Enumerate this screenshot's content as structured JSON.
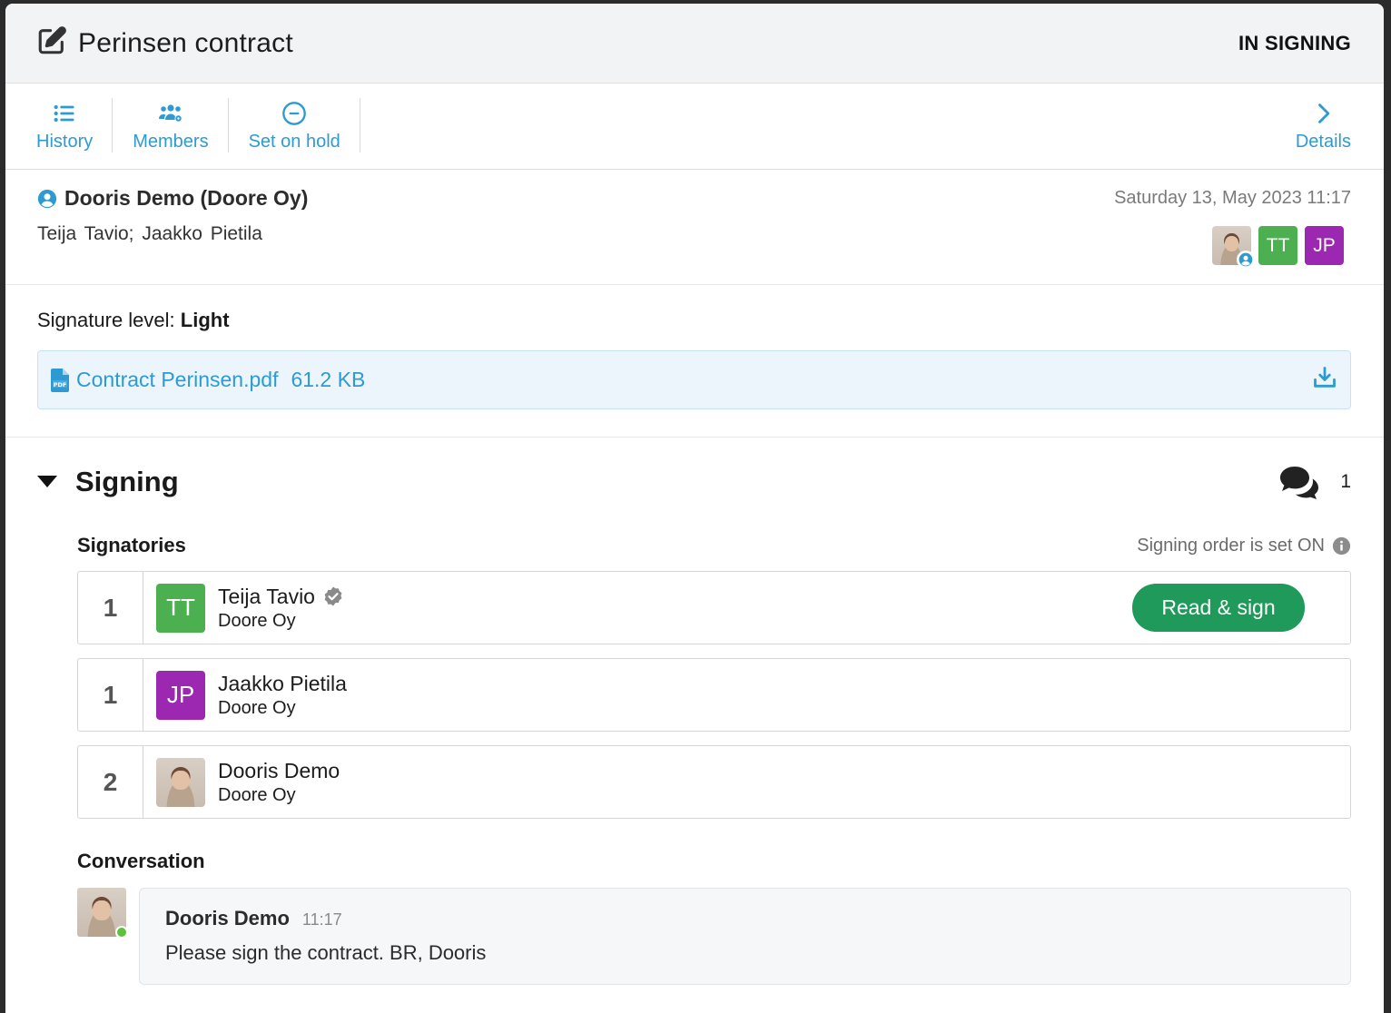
{
  "header": {
    "title": "Perinsen contract",
    "status": "IN SIGNING"
  },
  "toolbar": {
    "history_label": "History",
    "members_label": "Members",
    "hold_label": "Set on hold",
    "details_label": "Details"
  },
  "meta": {
    "owner": "Dooris Demo (Doore Oy)",
    "date": "Saturday 13, May 2023 11:17",
    "members": "Teija Tavio;  Jaakko Pietila",
    "avatars": [
      "TT",
      "JP"
    ]
  },
  "document": {
    "signature_level_label": "Signature level:",
    "signature_level_value": "Light",
    "file_name": "Contract Perinsen.pdf",
    "file_size": "61.2 KB"
  },
  "signing": {
    "title": "Signing",
    "comment_count": "1",
    "signatories_title": "Signatories",
    "order_note": "Signing order is set ON",
    "signatories": [
      {
        "order": "1",
        "initials": "TT",
        "name": "Teija Tavio",
        "org": "Doore Oy",
        "action": "Read & sign"
      },
      {
        "order": "1",
        "initials": "JP",
        "name": "Jaakko Pietila",
        "org": "Doore Oy"
      },
      {
        "order": "2",
        "initials": "",
        "name": "Dooris Demo",
        "org": "Doore Oy"
      }
    ]
  },
  "conversation": {
    "title": "Conversation",
    "messages": [
      {
        "author": "Dooris Demo",
        "time": "11:17",
        "text": "Please sign the contract. BR, Dooris"
      }
    ]
  },
  "colors": {
    "accent": "#2d9bd1",
    "sign_button": "#1f9a5b",
    "tt": "#4caf50",
    "jp": "#9c27b0"
  }
}
